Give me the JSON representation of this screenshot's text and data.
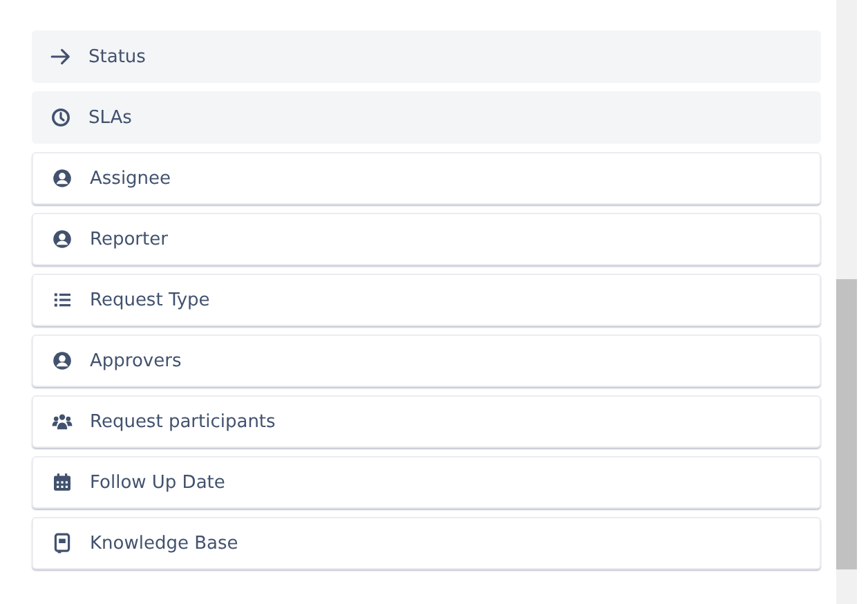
{
  "fields": [
    {
      "label": "Status",
      "kind": "arrow",
      "added": true
    },
    {
      "label": "SLAs",
      "kind": "clock",
      "added": true
    },
    {
      "label": "Assignee",
      "kind": "person",
      "added": false
    },
    {
      "label": "Reporter",
      "kind": "person",
      "added": false
    },
    {
      "label": "Request Type",
      "kind": "list",
      "added": false
    },
    {
      "label": "Approvers",
      "kind": "person",
      "added": false
    },
    {
      "label": "Request participants",
      "kind": "group",
      "added": false
    },
    {
      "label": "Follow Up Date",
      "kind": "calendar",
      "added": false
    },
    {
      "label": "Knowledge Base",
      "kind": "book",
      "added": false
    }
  ]
}
